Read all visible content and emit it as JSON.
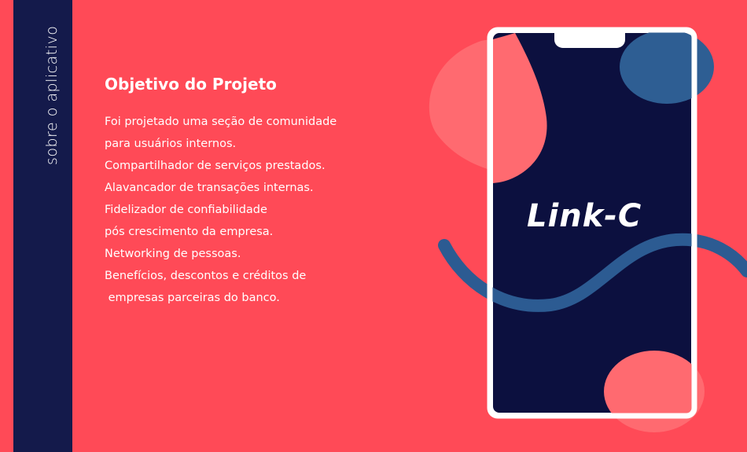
{
  "sidebar": {
    "label": "sobre o aplicativo"
  },
  "section": {
    "title": "Objetivo do Projeto",
    "lines": [
      "Foi projetado uma seção de comunidade",
      "para usuários internos.",
      "Compartilhador de serviços prestados.",
      "Alavancador de transações internas.",
      "Fidelizador de confiabilidade",
      "pós crescimento da empresa.",
      "Networking de pessoas.",
      "Benefícios, descontos e créditos de",
      " empresas parceiras do banco."
    ]
  },
  "phone": {
    "logo_text": "Link-C"
  },
  "colors": {
    "background": "#FF4A57",
    "band": "#141A4B",
    "screen": "#0C103F",
    "blob_pink": "#FF6A70",
    "blob_blue": "#2E5E93",
    "wave_blue": "#2C5B92"
  }
}
